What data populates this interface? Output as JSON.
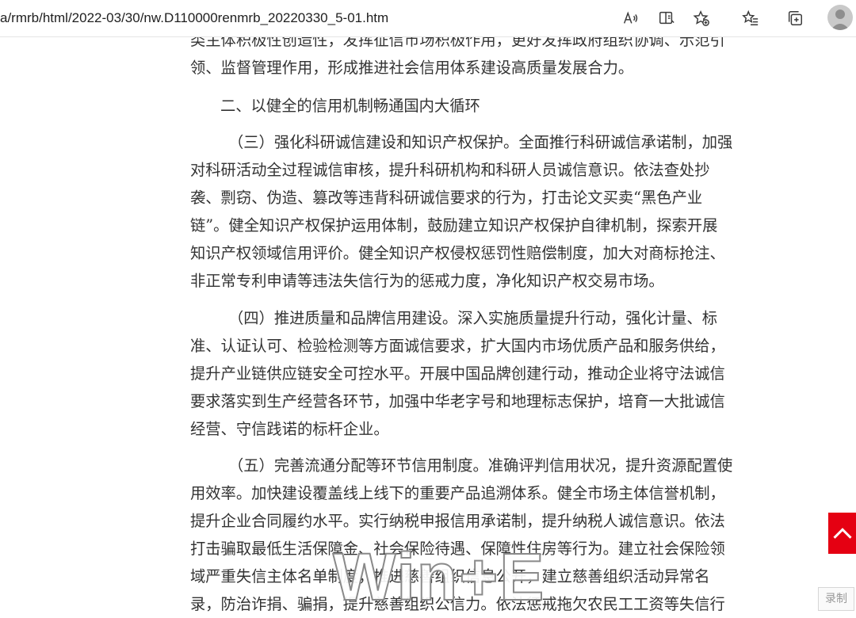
{
  "browser": {
    "url": "a/rmrb/html/2022-03/30/nw.D110000renmrb_20220330_5-01.htm"
  },
  "article": {
    "cut_line": "类主体积极性创造性，发挥征信市场积极作用，更好发挥政府组织协调、示范引",
    "intro_tail": "领、监督管理作用，形成推进社会信用体系建设高质量发展合力。",
    "section_heading": "二、以健全的信用机制畅通国内大循环",
    "para3": [
      "（三）强化科研诚信建设和知识产权保护。全面推行科研诚信承诺制，加强",
      "对科研活动全过程诚信审核，提升科研机构和科研人员诚信意识。依法查处抄",
      "袭、剽窃、伪造、篡改等违背科研诚信要求的行为，打击论文买卖“黑色产业",
      "链”。健全知识产权保护运用体制，鼓励建立知识产权保护自律机制，探索开展",
      "知识产权领域信用评价。健全知识产权侵权惩罚性赔偿制度，加大对商标抢注、",
      "非正常专利申请等违法失信行为的惩戒力度，净化知识产权交易市场。"
    ],
    "para4": [
      "（四）推进质量和品牌信用建设。深入实施质量提升行动，强化计量、标",
      "准、认证认可、检验检测等方面诚信要求，扩大国内市场优质产品和服务供给，",
      "提升产业链供应链安全可控水平。开展中国品牌创建行动，推动企业将守法诚信",
      "要求落实到生产经营各环节，加强中华老字号和地理标志保护，培育一大批诚信",
      "经营、守信践诺的标杆企业。"
    ],
    "para5": [
      "（五）完善流通分配等环节信用制度。准确评判信用状况，提升资源配置使",
      "用效率。加快建设覆盖线上线下的重要产品追溯体系。健全市场主体信誉机制，",
      "提升企业合同履约水平。实行纳税申报信用承诺制，提升纳税人诚信意识。依法",
      "打击骗取最低生活保障金、社会保险待遇、保障性住房等行为。建立社会保险领",
      "域严重失信主体名单制度，推进慈善组织信息公开，建立慈善组织活动异常名",
      "录，防治诈捐、骗捐，提升慈善组织公信力。依法惩戒拖欠农民工工资等失信行"
    ]
  },
  "overlay": {
    "watermark": "Win+E",
    "record_label": "录制"
  },
  "colors": {
    "back_to_top": "#e50012",
    "text": "#333333"
  },
  "icons": [
    "read-aloud-icon",
    "immersive-reader-icon",
    "add-favorite-icon",
    "favorites-icon",
    "collections-icon",
    "profile-avatar",
    "chevron-up-icon"
  ]
}
